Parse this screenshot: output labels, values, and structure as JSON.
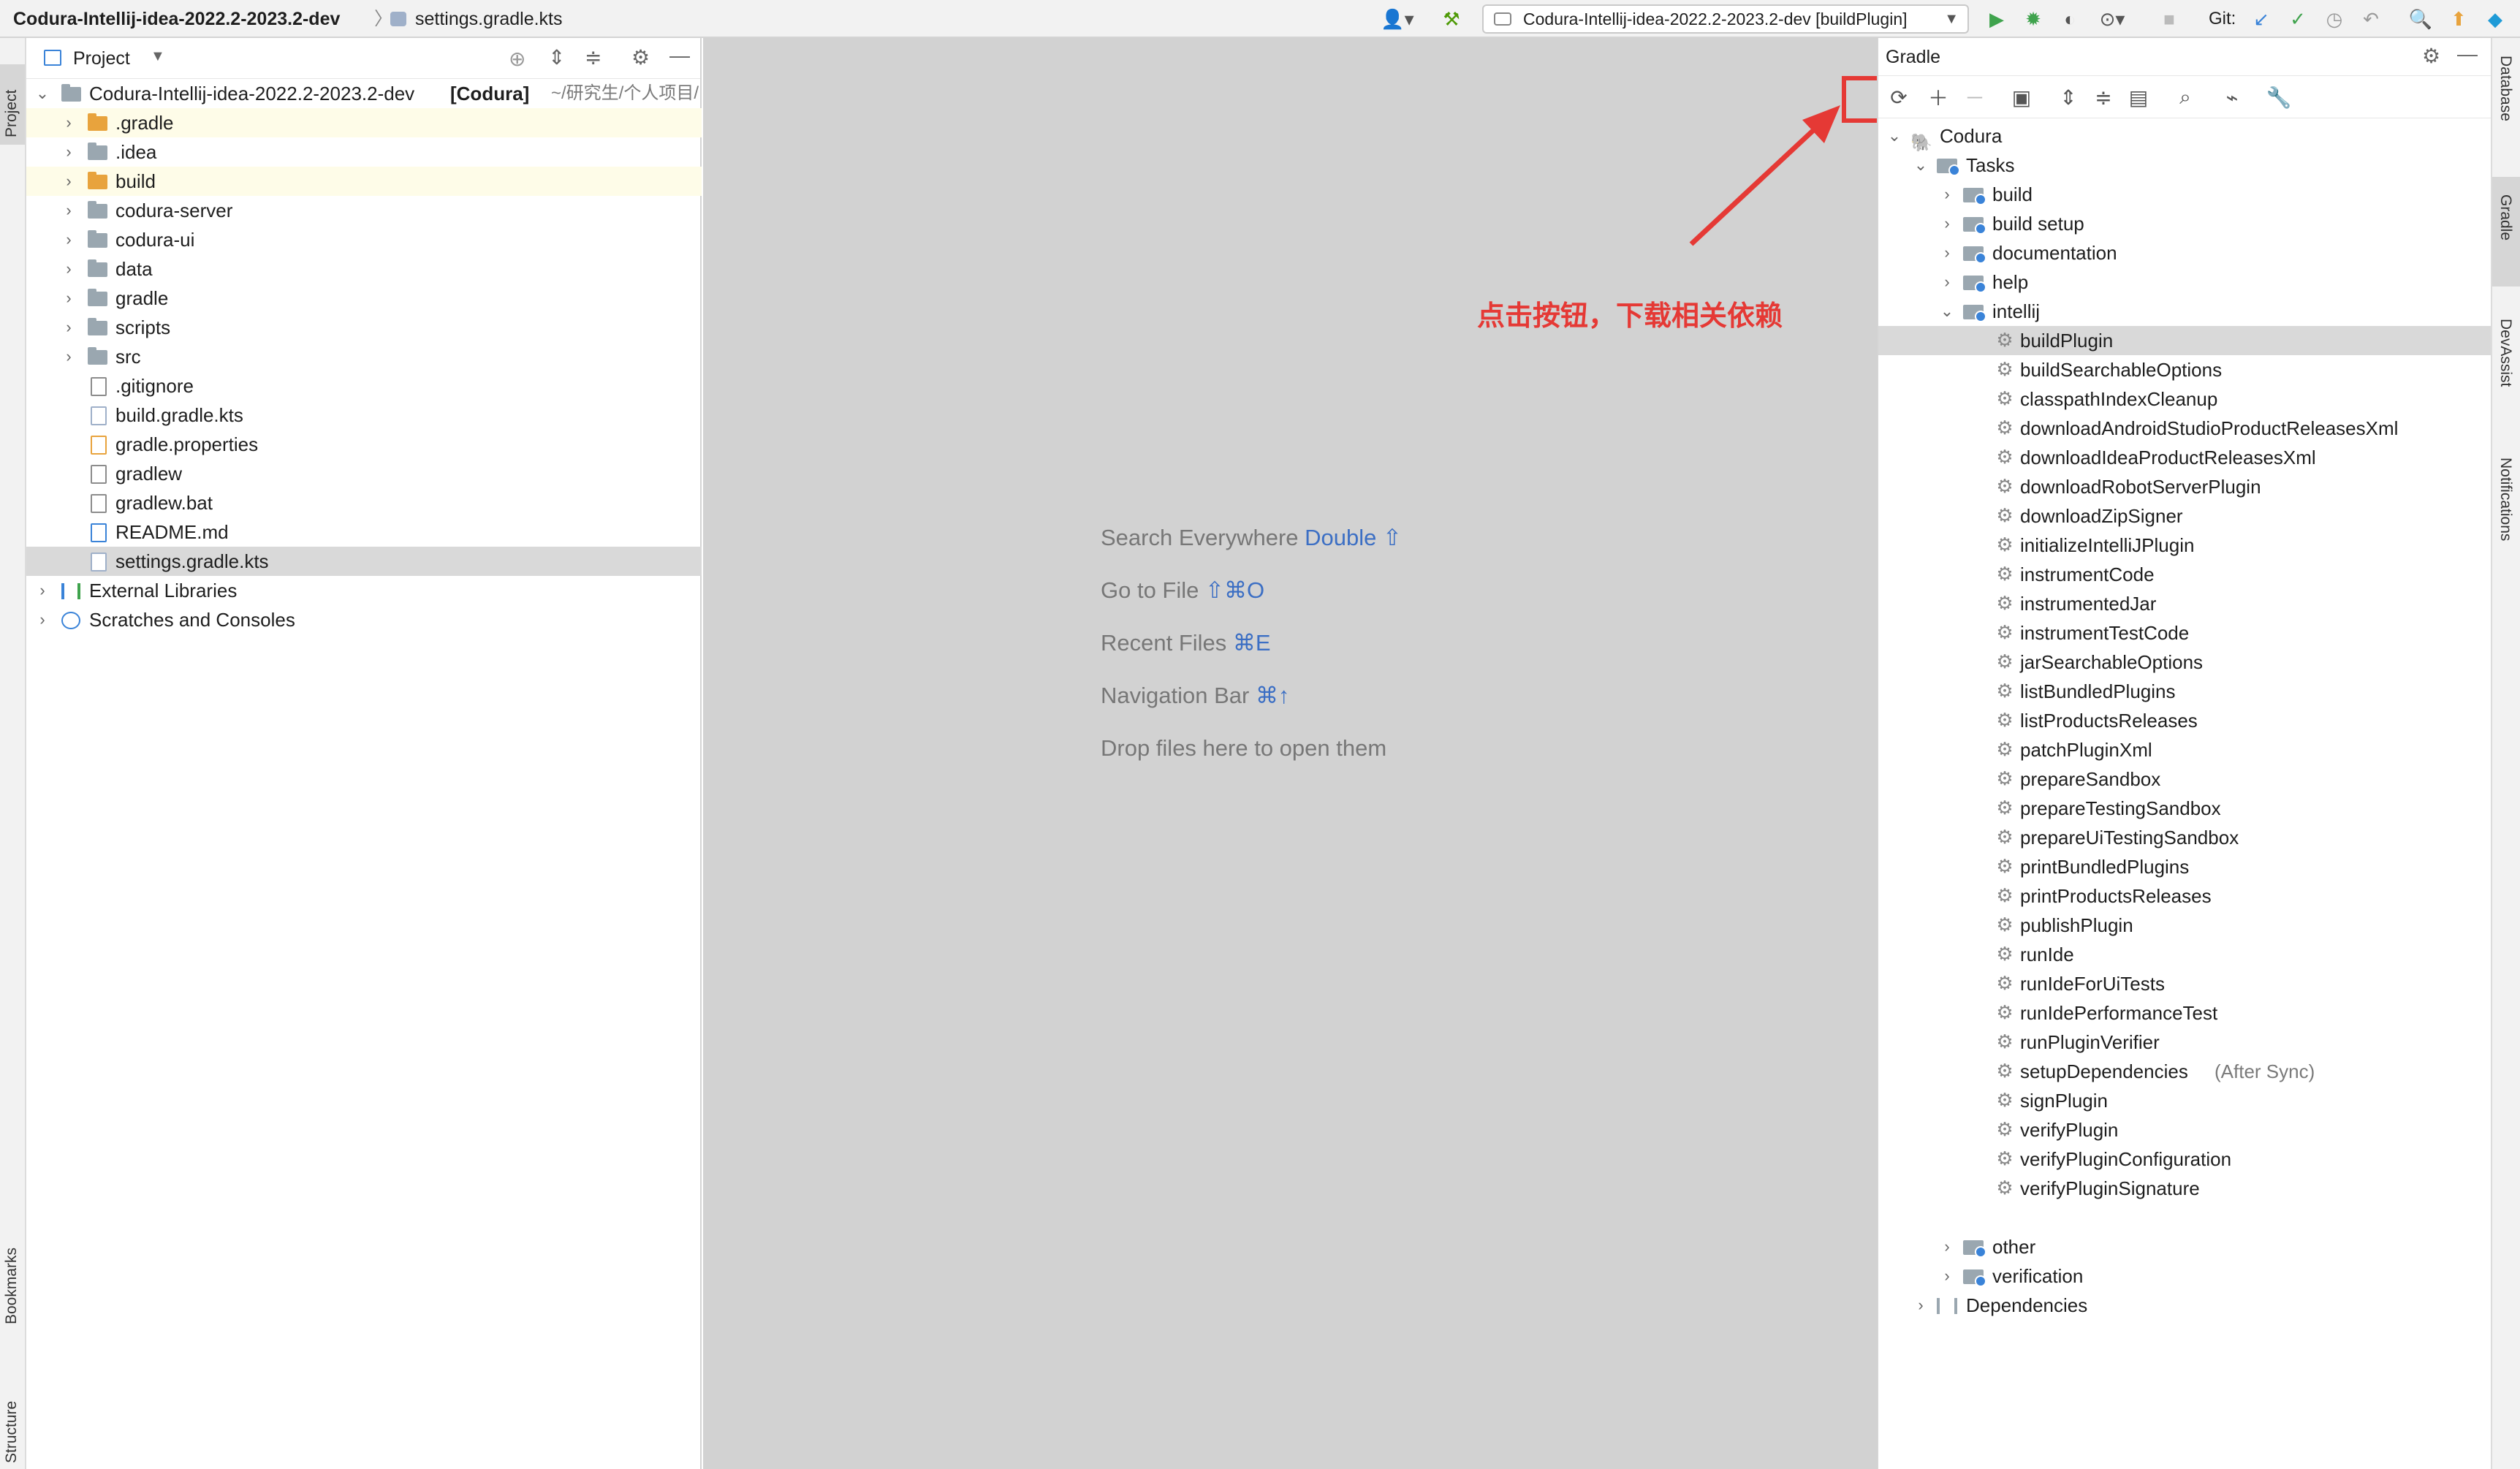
{
  "titlebar": {
    "project_name": "Codura-Intellij-idea-2022.2-2023.2-dev",
    "separator": "〉",
    "file_name": "settings.gradle.kts",
    "run_config": "Codura-Intellij-idea-2022.2-2023.2-dev [buildPlugin]",
    "git_label": "Git:"
  },
  "left_strip": {
    "project_tab": "Project",
    "bookmarks_tab": "Bookmarks",
    "structure_tab": "Structure"
  },
  "project_panel": {
    "title": "Project",
    "root": {
      "name": "Codura-Intellij-idea-2022.2-2023.2-dev",
      "module": "[Codura]",
      "path": "~/研究生/个人项目/"
    },
    "items": [
      {
        "name": ".gradle",
        "kind": "folder-orange",
        "expandable": true
      },
      {
        "name": ".idea",
        "kind": "folder",
        "expandable": true
      },
      {
        "name": "build",
        "kind": "folder-orange",
        "expandable": true
      },
      {
        "name": "codura-server",
        "kind": "folder",
        "expandable": true
      },
      {
        "name": "codura-ui",
        "kind": "folder",
        "expandable": true
      },
      {
        "name": "data",
        "kind": "folder",
        "expandable": true
      },
      {
        "name": "gradle",
        "kind": "folder",
        "expandable": true
      },
      {
        "name": "scripts",
        "kind": "folder",
        "expandable": true
      },
      {
        "name": "src",
        "kind": "folder",
        "expandable": true
      },
      {
        "name": ".gitignore",
        "kind": "file",
        "expandable": false
      },
      {
        "name": "build.gradle.kts",
        "kind": "file",
        "expandable": false
      },
      {
        "name": "gradle.properties",
        "kind": "file",
        "expandable": false
      },
      {
        "name": "gradlew",
        "kind": "file",
        "expandable": false
      },
      {
        "name": "gradlew.bat",
        "kind": "file",
        "expandable": false
      },
      {
        "name": "README.md",
        "kind": "file",
        "expandable": false
      },
      {
        "name": "settings.gradle.kts",
        "kind": "file",
        "expandable": false
      }
    ],
    "external_libraries": "External Libraries",
    "scratches": "Scratches and Consoles"
  },
  "editor": {
    "hints": [
      {
        "text": "Search Everywhere",
        "key": "Double ⇧"
      },
      {
        "text": "Go to File",
        "key": "⇧⌘O"
      },
      {
        "text": "Recent Files",
        "key": "⌘E"
      },
      {
        "text": "Navigation Bar",
        "key": "⌘↑"
      },
      {
        "text": "Drop files here to open them",
        "key": ""
      }
    ]
  },
  "annotation": {
    "text": "点击按钮，下载相关依赖",
    "color": "#e53935"
  },
  "gradle_panel": {
    "title": "Gradle",
    "root": "Codura",
    "tasks_label": "Tasks",
    "task_groups": [
      "build",
      "build setup",
      "documentation",
      "help",
      "intellij"
    ],
    "intellij_tasks": [
      "buildPlugin",
      "buildSearchableOptions",
      "classpathIndexCleanup",
      "downloadAndroidStudioProductReleasesXml",
      "downloadIdeaProductReleasesXml",
      "downloadRobotServerPlugin",
      "downloadZipSigner",
      "initializeIntelliJPlugin",
      "instrumentCode",
      "instrumentedJar",
      "instrumentTestCode",
      "jarSearchableOptions",
      "listBundledPlugins",
      "listProductsReleases",
      "patchPluginXml",
      "prepareSandbox",
      "prepareTestingSandbox",
      "prepareUiTestingSandbox",
      "printBundledPlugins",
      "printProductsReleases",
      "publishPlugin",
      "runIde",
      "runIdeForUiTests",
      "runIdePerformanceTest",
      "runPluginVerifier",
      "setupDependencies",
      "signPlugin",
      "verifyPlugin",
      "verifyPluginConfiguration",
      "verifyPluginSignature"
    ],
    "setup_dependencies_suffix": "(After Sync)",
    "selected_task": "buildPlugin",
    "after_groups": [
      "other",
      "verification"
    ],
    "dependencies": "Dependencies"
  },
  "right_strip": {
    "database_tab": "Database",
    "gradle_tab": "Gradle",
    "devassist_tab": "DevAssist",
    "notifications_tab": "Notifications"
  }
}
